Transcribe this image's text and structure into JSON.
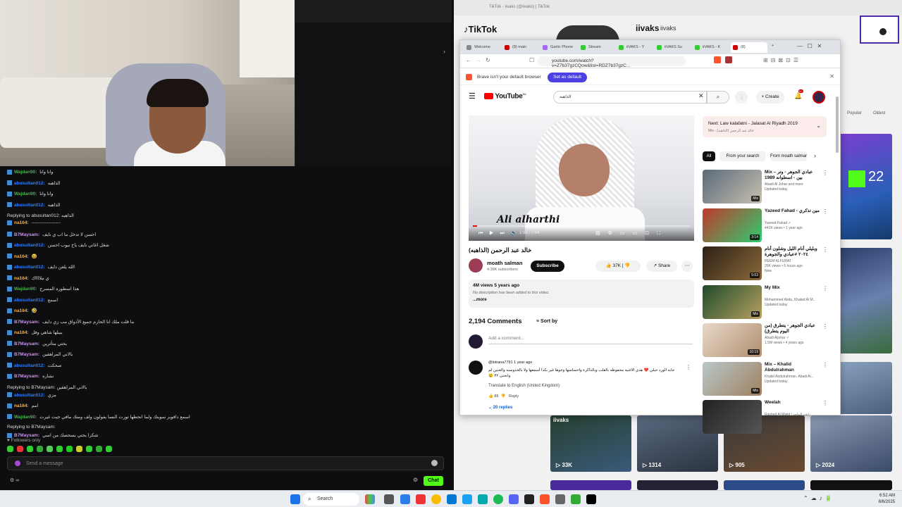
{
  "chat": {
    "messages": [
      {
        "user": "Wajdan90:",
        "text": "وانا وانا",
        "color": "#4caf50"
      },
      {
        "user": "abusultan012:",
        "text": "الذاهبه",
        "color": "#2e7dff"
      },
      {
        "user": "Wajdan90:",
        "text": "وانا وانا",
        "color": "#4caf50"
      },
      {
        "user": "abusultan012:",
        "text": "الذاهبه",
        "color": "#2e7dff"
      },
      {
        "reply": "Replying to abusultan012: الذاهبه"
      },
      {
        "user": "na164:",
        "text": "-------------------",
        "color": "#ffb347"
      },
      {
        "user": "B7Maysam:",
        "text": "احسن لا تدخل ما اب ي نايف",
        "color": "#c792ea"
      },
      {
        "user": "abusultan012:",
        "text": "شغل اغاني نايف ياخ نيوب احسن",
        "color": "#2e7dff"
      },
      {
        "user": "na164:",
        "text": "😆",
        "color": "#ffb347"
      },
      {
        "user": "abusultan012:",
        "text": "الله يلعن دايف",
        "color": "#2e7dff"
      },
      {
        "user": "na164:",
        "text": "ي ملااااك",
        "color": "#ffb347"
      },
      {
        "user": "Wajdan90:",
        "text": "هذا اسطوره المسرح",
        "color": "#4caf50"
      },
      {
        "user": "abusultan012:",
        "text": "اسمع",
        "color": "#2e7dff"
      },
      {
        "user": "na164:",
        "text": "🤣",
        "color": "#ffb347"
      },
      {
        "user": "B7Maysam:",
        "text": "ما قلت ملك انا الحارم جميع الأذواق مب زي دايف",
        "color": "#c792ea"
      },
      {
        "user": "na164:",
        "text": "يبيلها شاهي وفل",
        "color": "#ffb347"
      },
      {
        "user": "B7Maysam:",
        "text": "بحتي متأثرين",
        "color": "#c792ea"
      },
      {
        "user": "B7Maysam:",
        "text": "بالاني المراهقين",
        "color": "#c792ea"
      },
      {
        "user": "abusultan012:",
        "text": "صحكت",
        "color": "#2e7dff"
      },
      {
        "user": "B7Maysam:",
        "text": "نشاره",
        "color": "#c792ea"
      },
      {
        "reply": "Replying to B7Maysam: بالاني المراهقين"
      },
      {
        "user": "abusultan012:",
        "text": "مزي",
        "color": "#2e7dff"
      },
      {
        "user": "na164:",
        "text": "امم",
        "color": "#ffb347"
      },
      {
        "user": "Wajdan90:",
        "text": "اسمع دافوير سويتك ولما انحطها تورت النسا يفولون ولف ومنك مافي جيت غيرت",
        "color": "#4caf50"
      },
      {
        "reply": "Replying to B7Maysam:"
      },
      {
        "user": "B7Maysam:",
        "text": "شكرا بحتي بسحصك من اسي",
        "color": "#c792ea"
      }
    ],
    "followers_only": "Followers only",
    "input_placeholder": "Send a message",
    "chat_button": "Chat"
  },
  "tiktok": {
    "logo": "TikTok",
    "username": "iivaks",
    "handle": "iivaks",
    "window_title": "TikTok - iivaks (@iivaks) | TikTok",
    "sort_popular": "Popular",
    "sort_oldest": "Oldest",
    "grid_counts": [
      "33K",
      "1314",
      "905",
      "2024"
    ],
    "live_number": "22",
    "watermark": "iivaks"
  },
  "browser": {
    "tabs": [
      "Welcome",
      "(8) main",
      "Gartic Phone",
      "Stream",
      "iiVAKS - Y",
      "iiVAKS Su",
      "iiVAKS - K",
      "(8)"
    ],
    "url": "youtube.com/watch?v=Z7b37gzCQow&list=RDZ7b37gzC...",
    "notice": "Brave isn't your default browser",
    "notice_button": "Set as default"
  },
  "youtube": {
    "logo": "YouTube",
    "country": "SA",
    "search_value": "الذاهبه",
    "create": "Create",
    "notif_count": "9+",
    "video_title": "خالد عبد الرحمن (الذاهبه)",
    "overlay_text": "Ali alharthi",
    "time": "1:08 / 7:44",
    "channel": "moath salman",
    "subs": "4.39K subscribers",
    "subscribe": "Subscribe",
    "likes": "37K",
    "share": "Share",
    "views": "4M views  5 years ago",
    "desc": "No description has been added to this video.",
    "more": "...more",
    "comments_count": "2,194 Comments",
    "sort_by": "Sort by",
    "add_comment": "Add a comment...",
    "comment": {
      "user": "@lotrana7791  1 year ago",
      "text": "جابه الورد حيلي ❤️ هذي الاغنية محفوظه بالقلب وبالذاكرة واحساسها وجوها غير بكذا أسمعها ولا بالخذوسبه والحنين لم وانحنى ٣٢ 😢",
      "translate": "Translate to English (United Kingdom)",
      "likes": "86",
      "reply": "Reply",
      "replies": "20 replies"
    },
    "next_label": "Next: Law kalafatni - Jalasat Al Riyadh 2019",
    "next_sub": "Mix - خالد عبد الرحمن (الذاهبه)",
    "chips": [
      "All",
      "From your search",
      "From moath salman"
    ],
    "recs": [
      {
        "title": "Mix – عبادي الجوهر - وتر بين - اسطوانه 1989",
        "meta": "Abadi Al Johar and more\nUpdated today",
        "badge": "Mix",
        "c1": "#5a6a7a",
        "c2": "#c8c0b0"
      },
      {
        "title": "Yazeed Fahad - مين تذكري",
        "meta": "Yazeed Fahad ✓\n441K views • 1 year ago",
        "badge": "3:14",
        "c1": "#c0392b",
        "c2": "#2ecc71"
      },
      {
        "title": "وبليلي أنام الليل وشلون أنام ٢٠٢٤ #عبادي والجوهرة",
        "meta": "REEM ALFURAT\n25K views • 5 hours ago\nNew",
        "badge": "5:03",
        "c1": "#2d2015",
        "c2": "#8a6a3a"
      },
      {
        "title": "My Mix",
        "meta": "Mohammed Abdu, Khaled Al M...\nUpdated today",
        "badge": "Mix",
        "c1": "#1e4a2a",
        "c2": "#b8a060"
      },
      {
        "title": "عبادي الجوهر - يتطرق (من اليوم يتطرق)",
        "meta": "Abadi Aljohar ✓\n1.5M views • 4 years ago",
        "badge": "10:19",
        "c1": "#e8d8c8",
        "c2": "#b09070"
      },
      {
        "title": "Mix – Khalid Abdulrahman",
        "meta": "Khalid Abdulrahman, Abadi Al...\nUpdated today",
        "badge": "Mix",
        "c1": "#b8c8c8",
        "c2": "#a08060"
      },
      {
        "title": "Weelah",
        "meta": "Rashed Al Majid | راشد الماجد",
        "badge": "",
        "c1": "#222",
        "c2": "#555"
      }
    ]
  },
  "taskbar": {
    "search": "Search",
    "time": "6:52 AM",
    "date": "8/6/2025"
  }
}
